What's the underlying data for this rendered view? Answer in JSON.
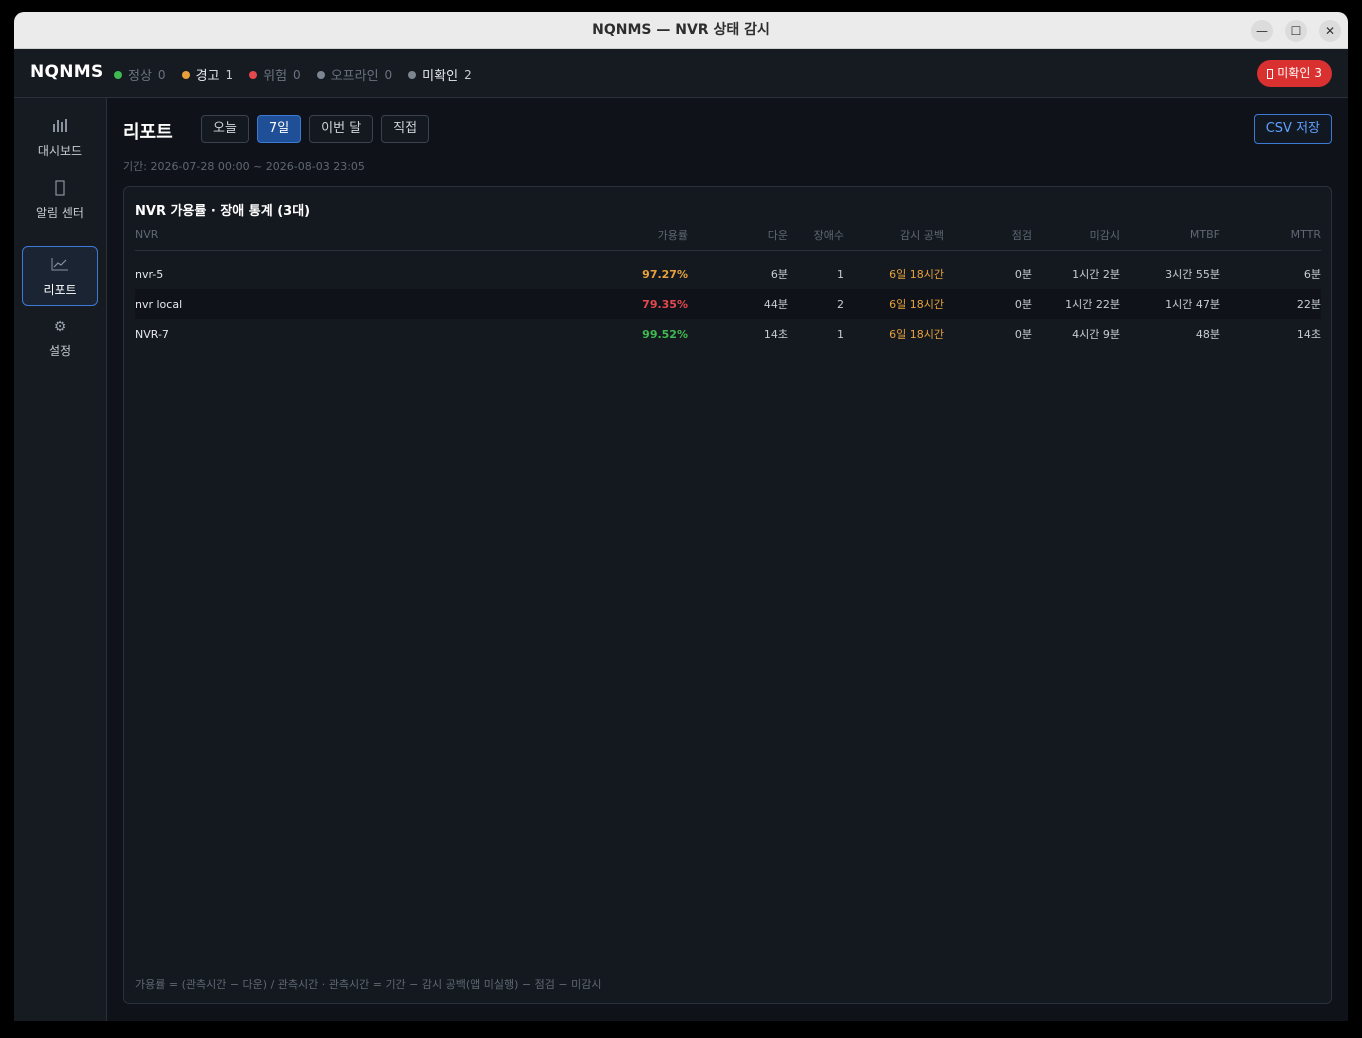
{
  "window": {
    "title": "NQNMS — NVR 상태 감시"
  },
  "header": {
    "brand": "NQNMS",
    "statuses": [
      {
        "label": "정상",
        "count": "0",
        "color": "#3fb950",
        "active": false
      },
      {
        "label": "경고",
        "count": "1",
        "color": "#e8a13a",
        "active": true
      },
      {
        "label": "위험",
        "count": "0",
        "color": "#e5484d",
        "active": false
      },
      {
        "label": "오프라인",
        "count": "0",
        "color": "#7d8590",
        "active": false
      },
      {
        "label": "미확인",
        "count": "2",
        "color": "#7d8590",
        "active": true
      }
    ],
    "unack_button": {
      "label": "미확인",
      "count": "3"
    }
  },
  "sidebar": {
    "items": [
      {
        "label": "대시보드",
        "icon": "bar-chart-icon",
        "active": false
      },
      {
        "label": "알림 센터",
        "icon": "bell-icon",
        "active": false
      },
      {
        "label": "리포트",
        "icon": "line-chart-icon",
        "active": true
      },
      {
        "label": "설정",
        "icon": "gear-icon",
        "active": false
      }
    ]
  },
  "report": {
    "title": "리포트",
    "ranges": [
      {
        "label": "오늘",
        "active": false
      },
      {
        "label": "7일",
        "active": true
      },
      {
        "label": "이번 달",
        "active": false
      },
      {
        "label": "직접",
        "active": false
      }
    ],
    "csv_label": "CSV 저장",
    "period": "기간: 2026-07-28 00:00 ~ 2026-08-03 23:05",
    "card_title": "NVR 가용률 · 장애 통계 (3대)",
    "columns": [
      "NVR",
      "가용률",
      "다운",
      "장애수",
      "감시 공백",
      "점검",
      "미감시",
      "MTBF",
      "MTTR"
    ],
    "rows": [
      {
        "nvr": "nvr-5",
        "avail": "97.27%",
        "avail_color": "#e8a13a",
        "down": "6분",
        "faults": "1",
        "gap": "6일 18시간",
        "maint": "0분",
        "unmon": "1시간 2분",
        "mtbf": "3시간 55분",
        "mttr": "6분"
      },
      {
        "nvr": "nvr local",
        "avail": "79.35%",
        "avail_color": "#e5484d",
        "down": "44분",
        "faults": "2",
        "gap": "6일 18시간",
        "maint": "0분",
        "unmon": "1시간 22분",
        "mtbf": "1시간 47분",
        "mttr": "22분"
      },
      {
        "nvr": "NVR-7",
        "avail": "99.52%",
        "avail_color": "#3fb950",
        "down": "14초",
        "faults": "1",
        "gap": "6일 18시간",
        "maint": "0분",
        "unmon": "4시간 9분",
        "mtbf": "48분",
        "mttr": "14초"
      }
    ],
    "footnote": "가용률 = (관측시간 − 다운) / 관측시간 · 관측시간 = 기간 − 감시 공백(앱 미실행) − 점검 − 미감시"
  }
}
